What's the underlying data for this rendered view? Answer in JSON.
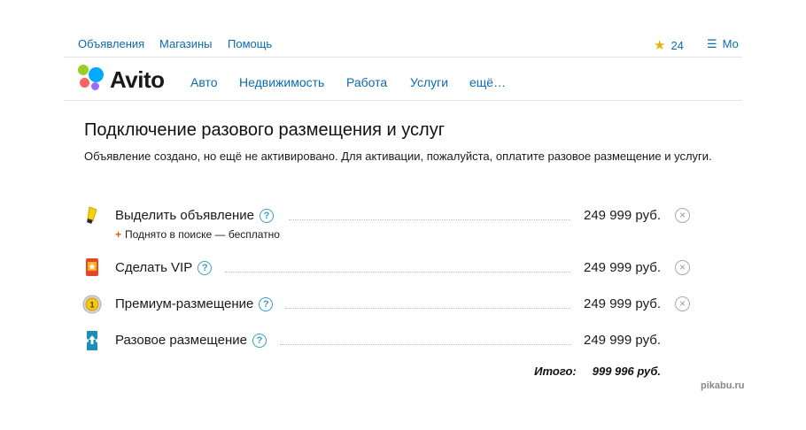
{
  "topbar": {
    "links": [
      "Объявления",
      "Магазины",
      "Помощь"
    ],
    "favorites_count": "24",
    "my_label": "Мо"
  },
  "logo": {
    "text": "Avito"
  },
  "nav": [
    "Авто",
    "Недвижимость",
    "Работа",
    "Услуги",
    "ещё…"
  ],
  "page": {
    "title": "Подключение разового размещения и услуг",
    "description": "Объявление создано, но ещё не активировано. Для активации, пожалуйста, оплатите разовое размещение и услуги."
  },
  "services": [
    {
      "label": "Выделить объявление",
      "price": "249 999 руб.",
      "icon": "highlighter-icon",
      "note": "Поднято в поиске — бесплатно"
    },
    {
      "label": "Сделать VIP",
      "price": "249 999 руб.",
      "icon": "vip-badge-icon"
    },
    {
      "label": "Премиум-размещение",
      "price": "249 999 руб.",
      "icon": "premium-coin-icon"
    },
    {
      "label": "Разовое размещение",
      "price": "249 999 руб.",
      "icon": "ticket-icon"
    }
  ],
  "total": {
    "label": "Итого:",
    "value": "999 996 руб."
  },
  "watermark": "pikabu.ru",
  "colors": {
    "link": "#0b6bb3",
    "help": "#3a9cc8",
    "star": "#e6b400",
    "plus": "#e25b0a",
    "logo_dots": [
      "#97cf26",
      "#0af",
      "#ff6163",
      "#a169f7"
    ]
  }
}
